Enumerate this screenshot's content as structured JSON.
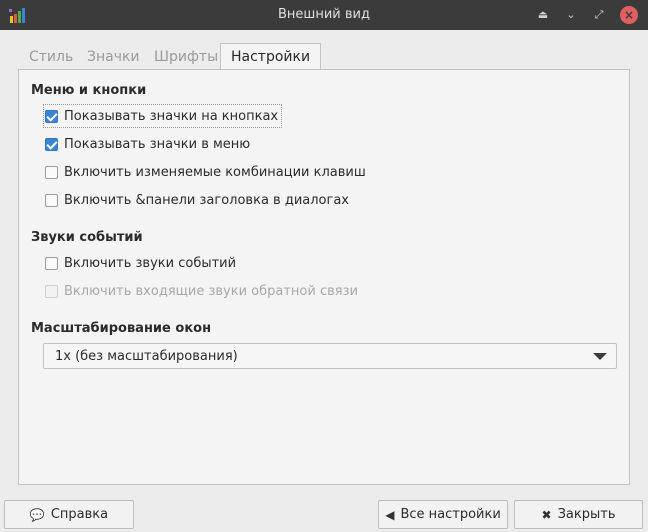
{
  "window": {
    "title": "Внешний вид"
  },
  "tabs": [
    {
      "label": "Стиль",
      "active": false
    },
    {
      "label": "Значки",
      "active": false
    },
    {
      "label": "Шрифты",
      "active": false
    },
    {
      "label": "Настройки",
      "active": true
    }
  ],
  "menus_section": {
    "title": "Меню и кнопки",
    "items": [
      {
        "label": "Показывать значки на кнопках",
        "checked": true,
        "enabled": true
      },
      {
        "label": "Показывать значки в меню",
        "checked": true,
        "enabled": true
      },
      {
        "label": "Включить изменяемые комбинации клавиш",
        "checked": false,
        "enabled": true
      },
      {
        "label": "Включить &панели заголовка в диалогах",
        "checked": false,
        "enabled": true
      }
    ]
  },
  "sounds_section": {
    "title": "Звуки событий",
    "items": [
      {
        "label": "Включить звуки событий",
        "checked": false,
        "enabled": true
      },
      {
        "label": "Включить входящие звуки обратной связи",
        "checked": false,
        "enabled": false
      }
    ]
  },
  "scaling_section": {
    "title": "Масштабирование окон",
    "selected": "1x (без масштабирования)"
  },
  "buttons": {
    "help": "Справка",
    "all_settings": "Все настройки",
    "close": "Закрыть"
  },
  "colors": {
    "accent": "#3c85d6",
    "titlebar": "#3b3b3b",
    "close_button": "#e06060"
  }
}
